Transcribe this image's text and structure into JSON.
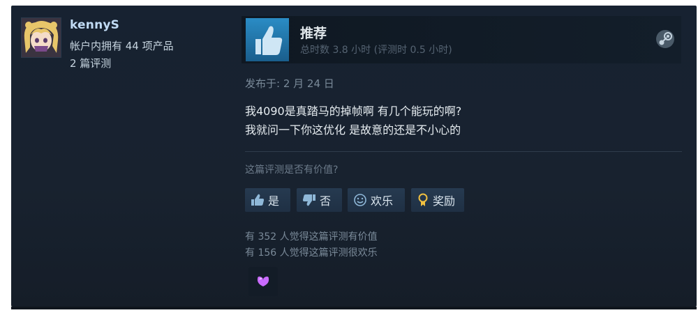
{
  "author": {
    "name": "kennyS",
    "products": "帐户内拥有 44 项产品",
    "reviews": "2 篇评测"
  },
  "recommendation": {
    "title": "推荐",
    "hours": "总时数 3.8 小时  (评测时 0.5 小时)"
  },
  "review": {
    "posted": "发布于: 2 月 24 日",
    "lines": [
      "我4090是真踏马的掉帧啊 有几个能玩的啊?",
      "我就问一下你这优化 是故意的还是不小心的"
    ]
  },
  "feedback": {
    "question": "这篇评测是否有价值?",
    "yes": "是",
    "no": "否",
    "funny": "欢乐",
    "award": "奖励",
    "helpful_stat": "有 352 人觉得这篇评测有价值",
    "funny_stat": "有 156 人觉得这篇评测很欢乐"
  },
  "colors": {
    "card_bg": "#1b2838",
    "accent_blue": "#2a8cc5",
    "name": "#c1dbf4",
    "award_purple": "#c96bff"
  },
  "icons": [
    "thumbs-up-icon",
    "steam-icon",
    "thumbs-down-icon",
    "smiley-icon",
    "medal-icon",
    "award-badge-icon"
  ]
}
